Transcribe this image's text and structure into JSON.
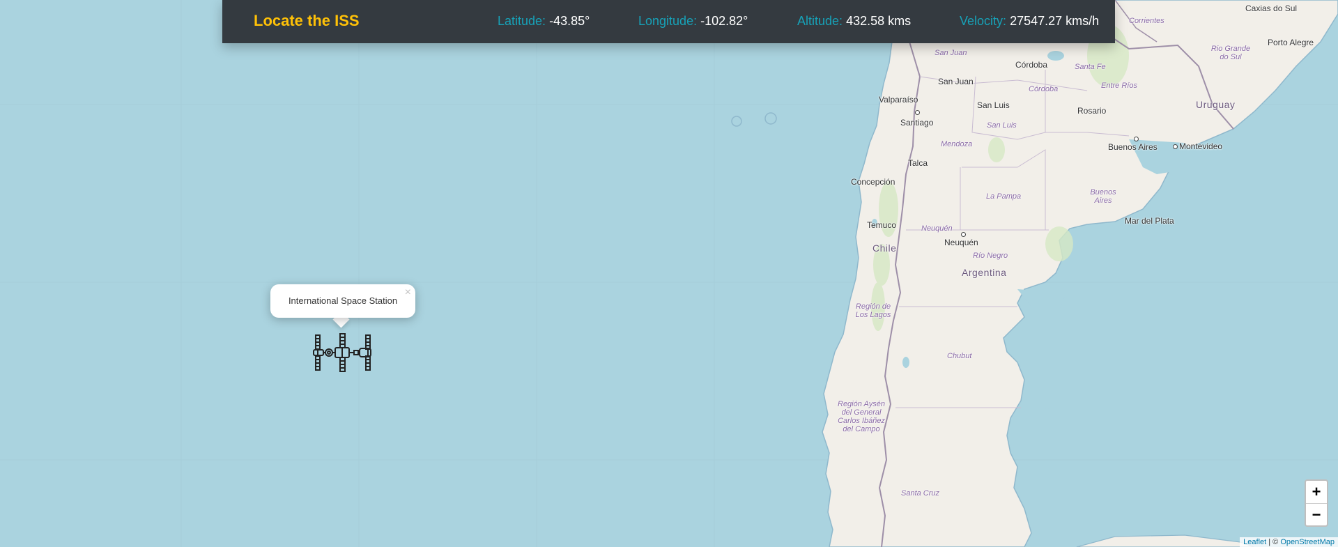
{
  "header": {
    "title": "Locate the ISS",
    "latitude_label": "Latitude:",
    "latitude_value": "-43.85°",
    "longitude_label": "Longitude:",
    "longitude_value": "-102.82°",
    "altitude_label": "Altitude:",
    "altitude_value": "432.58 kms",
    "velocity_label": "Velocity:",
    "velocity_value": "27547.27 kms/h"
  },
  "colors": {
    "header_bg": "#343a40",
    "brand": "#ffc107",
    "stat_label": "#17a2b8",
    "water": "#aad3df",
    "land": "#f2efe9",
    "border": "#9e8fa8"
  },
  "popup": {
    "text": "International Space Station",
    "close": "×"
  },
  "marker": {
    "icon": "space-station-icon"
  },
  "map_labels": {
    "caxias": "Caxias do Sul",
    "porto_alegre": "Porto Alegre",
    "corrientes": "Corrientes",
    "rio_grande_do_sul": "Rio Grande do Sul",
    "san_juan_prov": "San Juan",
    "san_juan": "San Juan",
    "cordoba": "Córdoba",
    "cordoba_prov": "Córdoba",
    "santa_fe": "Santa Fe",
    "entre_rios": "Entre Ríos",
    "uruguay": "Uruguay",
    "valparaiso": "Valparaíso",
    "santiago": "Santiago",
    "san_luis": "San Luis",
    "san_luis_prov": "San Luis",
    "rosario": "Rosario",
    "buenos_aires": "Buenos Aires",
    "montevideo": "Montevideo",
    "mendoza": "Mendoza",
    "talca": "Talca",
    "concepcion": "Concepción",
    "la_pampa": "La Pampa",
    "buenos_aires_prov": "Buenos Aires",
    "mar_del_plata": "Mar del Plata",
    "temuco": "Temuco",
    "neuquen_prov": "Neuquén",
    "neuquen": "Neuquén",
    "chile": "Chile",
    "rio_negro": "Río Negro",
    "argentina": "Argentina",
    "los_lagos": "Región de Los Lagos",
    "chubut": "Chubut",
    "aysen": "Región Aysén del General Carlos Ibáñez del Campo",
    "santa_cruz": "Santa Cruz"
  },
  "zoom": {
    "in": "+",
    "out": "−"
  },
  "attribution": {
    "leaflet": "Leaflet",
    "separator": " | © ",
    "osm": "OpenStreetMap"
  }
}
